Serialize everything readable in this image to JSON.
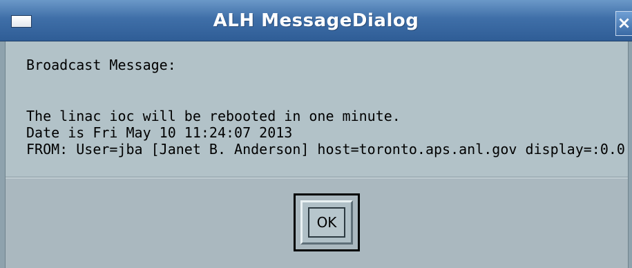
{
  "window": {
    "title": "ALH MessageDialog",
    "close_glyph": "✕",
    "menu_icon": "window-menu-icon"
  },
  "message": {
    "header": "Broadcast Message:",
    "lines": [
      "The linac ioc will be rebooted in one minute.",
      "Date is Fri May 10 11:24:07 2013",
      "FROM: User=jba [Janet B. Anderson] host=toronto.aps.anl.gov display=:0.0"
    ]
  },
  "buttons": {
    "ok_label": "OK"
  },
  "colors": {
    "titlebar": "#3f6fa8",
    "background": "#b0c1c8"
  }
}
